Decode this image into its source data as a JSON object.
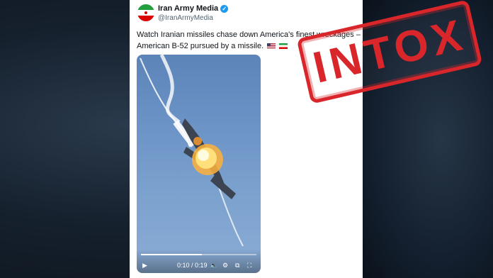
{
  "post": {
    "author_name": "Iran Army Media",
    "author_handle": "@IranArmyMedia",
    "verified_icon": "check-icon",
    "text_line1": "Watch Iranian missiles chase down America's finest wreckages – an",
    "text_line2": "American B-52 pursued by a missile.",
    "text_emojis": [
      "us-flag-icon",
      "iran-flag-icon"
    ]
  },
  "video": {
    "current_time": "0:10",
    "separator": " / ",
    "duration": "0:19",
    "progress_fraction": 0.53,
    "controls": [
      "play-icon",
      "volume-icon",
      "settings-icon",
      "fit-icon",
      "fullscreen-icon"
    ]
  },
  "stamp": {
    "text": "INTOX",
    "color": "#d9262b"
  },
  "colors": {
    "verified": "#1d9bf0",
    "text": "#0f1419",
    "handle": "#536471"
  }
}
